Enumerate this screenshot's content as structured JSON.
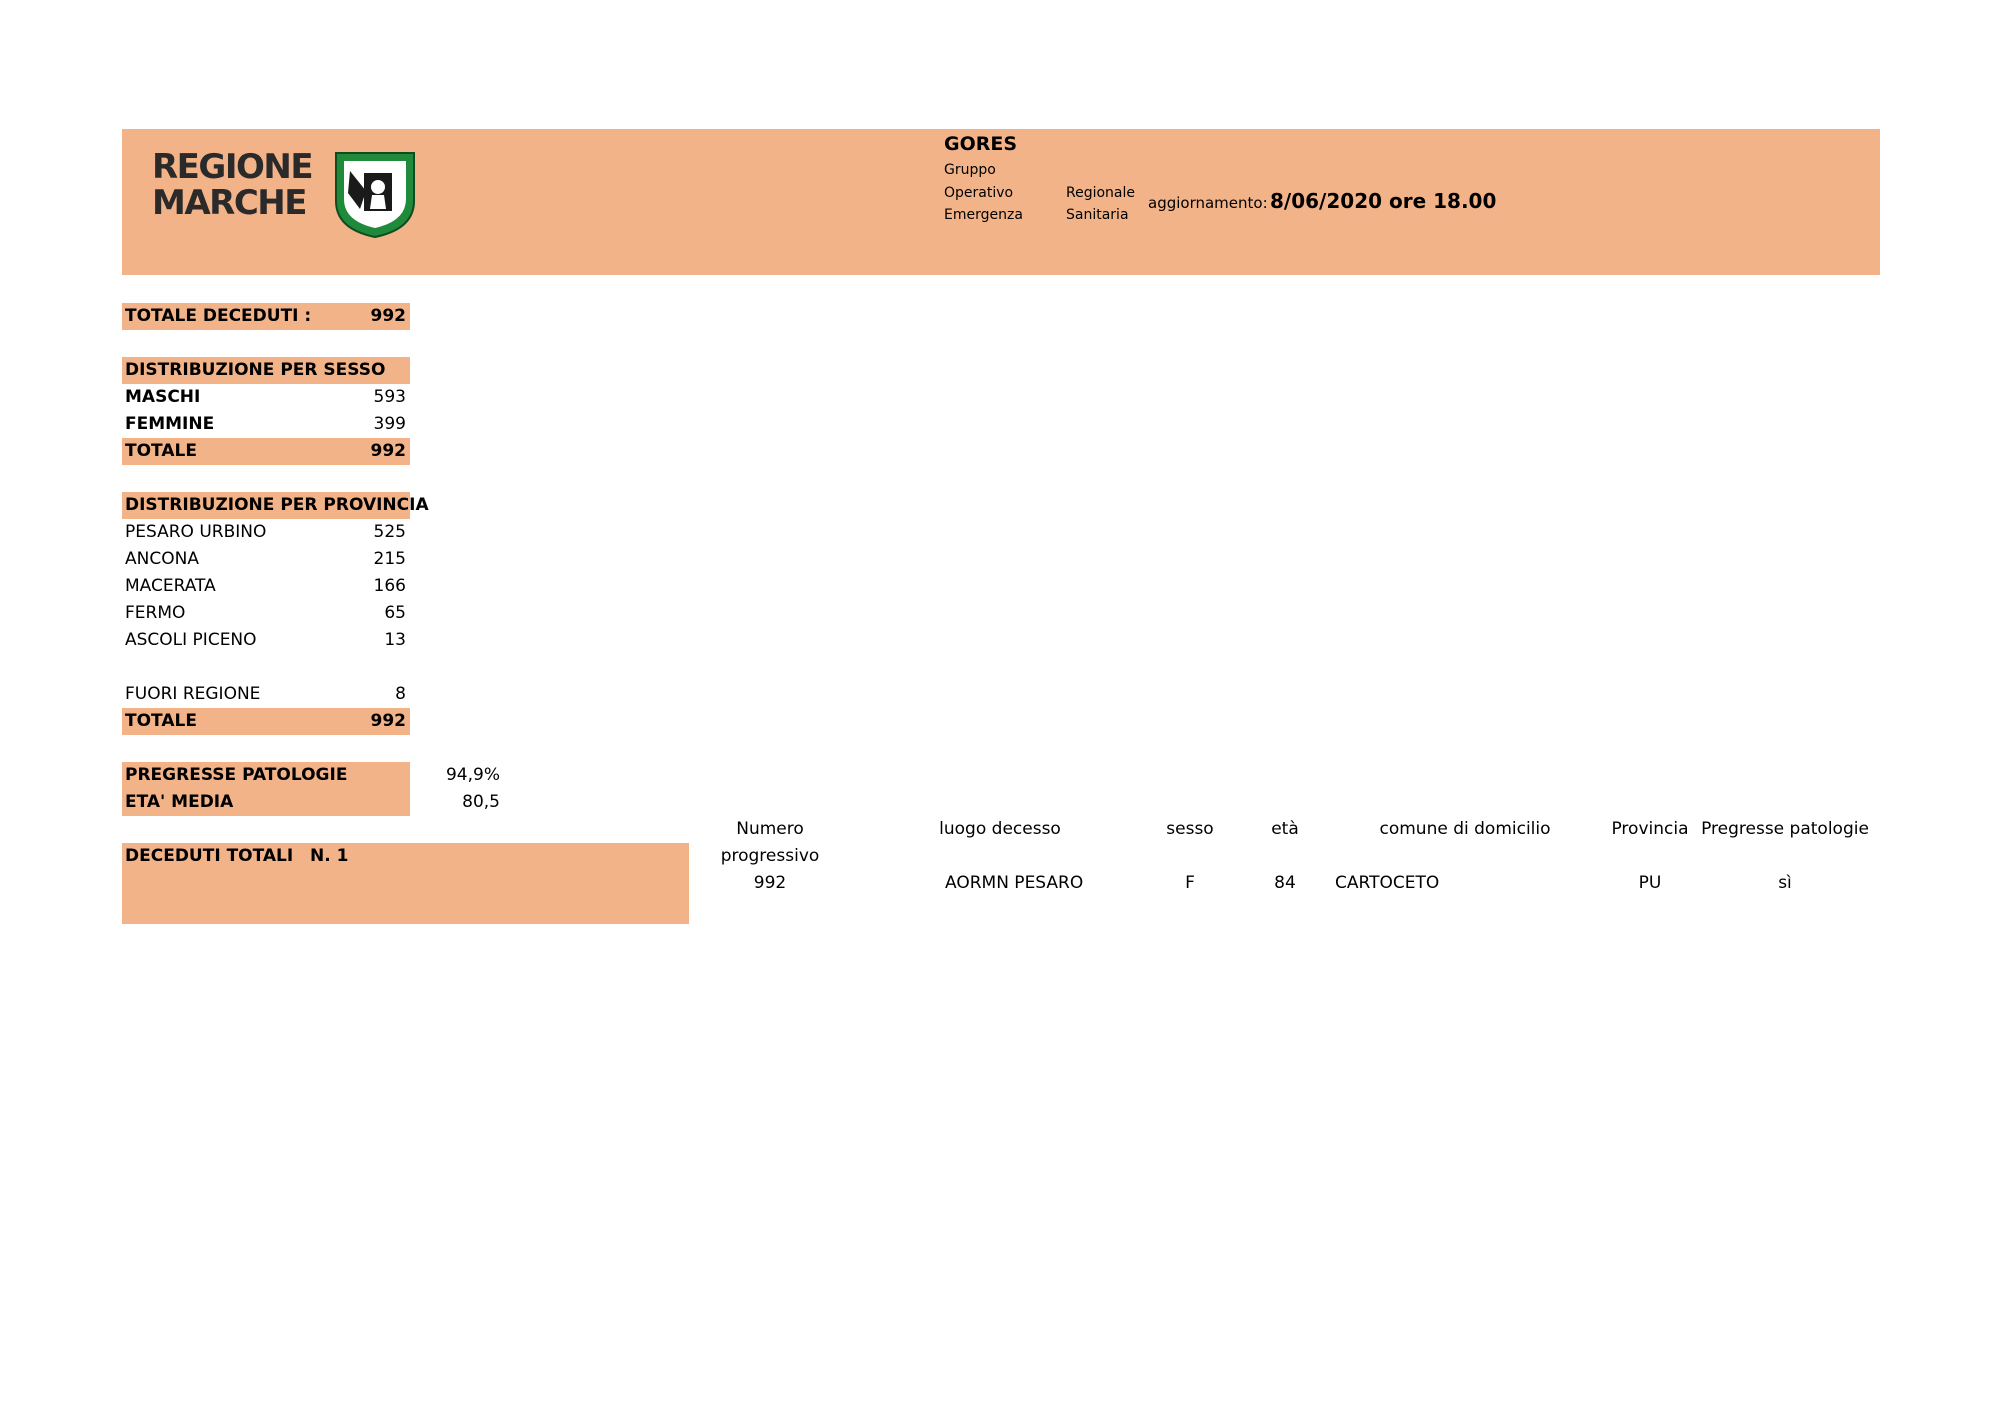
{
  "header": {
    "logo_line1": "REGIONE",
    "logo_line2": "MARCHE",
    "title": "GORES",
    "sub": {
      "gruppo": "Gruppo",
      "operativo": "Operativo",
      "regionale": "Regionale",
      "emergenza": "Emergenza",
      "sanitaria": "Sanitaria"
    },
    "update_label": "aggiornamento:",
    "update_value": "8/06/2020 ore 18.00",
    "colors": {
      "banner": "#f3b388",
      "shield_green": "#1f8a3a"
    }
  },
  "totale_deceduti": {
    "label": "TOTALE DECEDUTI :",
    "value": "992"
  },
  "sesso": {
    "title": "DISTRIBUZIONE PER SESSO",
    "rows": [
      {
        "label": "MASCHI",
        "value": "593"
      },
      {
        "label": "FEMMINE",
        "value": "399"
      }
    ],
    "total_label": "TOTALE",
    "total_value": "992"
  },
  "provincia": {
    "title": "DISTRIBUZIONE PER PROVINCIA",
    "rows": [
      {
        "label": "PESARO URBINO",
        "value": "525"
      },
      {
        "label": "ANCONA",
        "value": "215"
      },
      {
        "label": "MACERATA",
        "value": "166"
      },
      {
        "label": "FERMO",
        "value": "65"
      },
      {
        "label": "ASCOLI PICENO",
        "value": "13"
      }
    ],
    "fuori_label": "FUORI REGIONE",
    "fuori_value": "8",
    "total_label": "TOTALE",
    "total_value": "992"
  },
  "stats": {
    "patologie_label": "PREGRESSE PATOLOGIE",
    "patologie_value": "94,9%",
    "eta_label": "ETA' MEDIA",
    "eta_value": "80,5"
  },
  "deceduti_totali": {
    "label": "DECEDUTI TOTALI",
    "value": "N. 1"
  },
  "table": {
    "headers": {
      "numero_line1": "Numero",
      "numero_line2": "progressivo",
      "luogo": "luogo decesso",
      "sesso": "sesso",
      "eta": "età",
      "comune": "comune di domicilio",
      "provincia": "Provincia",
      "patologie": "Pregresse patologie"
    },
    "rows": [
      {
        "numero": "992",
        "luogo": "AORMN PESARO",
        "sesso": "F",
        "eta": "84",
        "comune": "CARTOCETO",
        "provincia": "PU",
        "patologie": "sì"
      }
    ]
  }
}
